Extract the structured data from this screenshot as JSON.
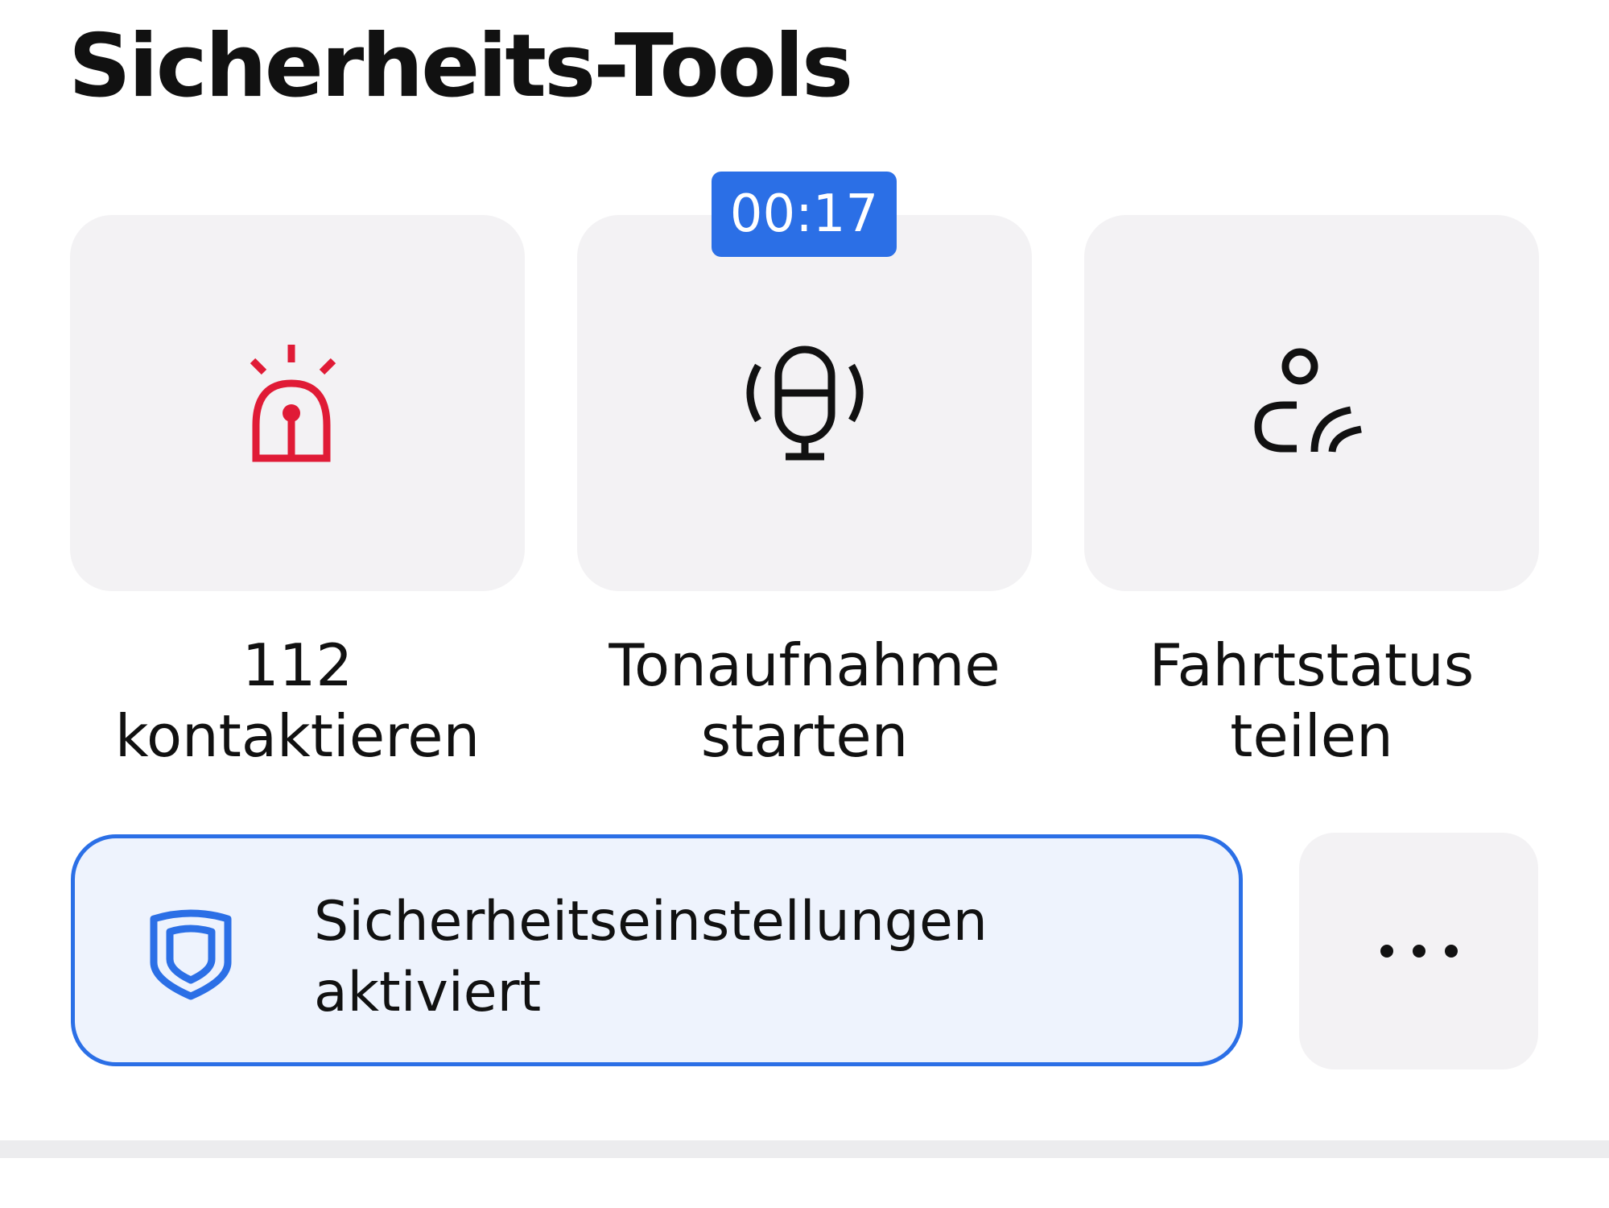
{
  "header": {
    "title": "Sicherheits-Tools"
  },
  "tools": [
    {
      "icon": "emergency-siren-icon",
      "label_line1": "112",
      "label_line2": "kontaktieren"
    },
    {
      "icon": "microphone-recording-icon",
      "label_line1": "Tonaufnahme",
      "label_line2": "starten",
      "timer": "00:17"
    },
    {
      "icon": "share-ride-status-icon",
      "label_line1": "Fahrtstatus",
      "label_line2": "teilen"
    }
  ],
  "safety_status": {
    "icon": "shield-icon",
    "line1": "Sicherheitseinstellungen",
    "line2": "aktiviert"
  },
  "more": {
    "icon": "more-dots-icon"
  },
  "colors": {
    "accent": "#2b6fe6",
    "emergency": "#e01b36",
    "card_background": "#f3f2f4",
    "status_background": "#eef3fd",
    "text": "#111111"
  }
}
